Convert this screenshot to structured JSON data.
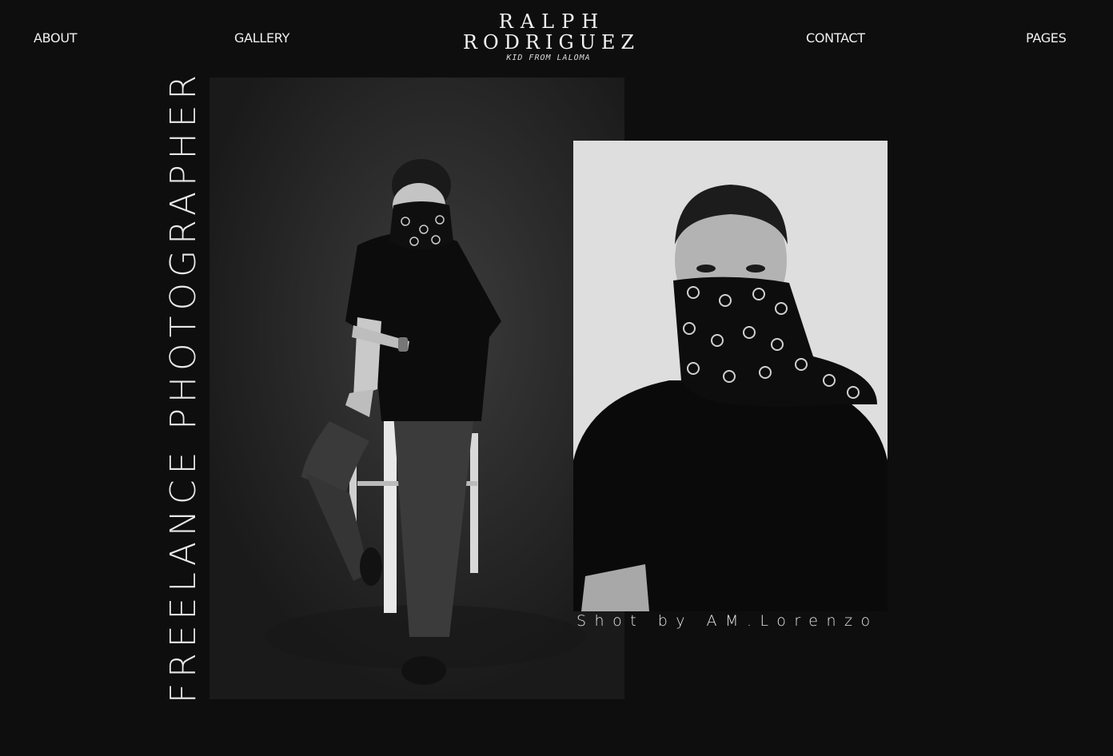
{
  "nav": {
    "about": "ABOUT",
    "gallery": "GALLERY",
    "contact": "CONTACT",
    "pages": "PAGES"
  },
  "logo": {
    "line1": "RALPH",
    "line2": "RODRIGUEZ",
    "tagline": "KID FROM LALOMA"
  },
  "hero": {
    "vertical_title": "FREELANCE PHOTOGRAPHER",
    "photo_credit": "Shot by AM.Lorenzo"
  },
  "colors": {
    "background": "#0e0e0f",
    "text": "#f0f0f0"
  }
}
